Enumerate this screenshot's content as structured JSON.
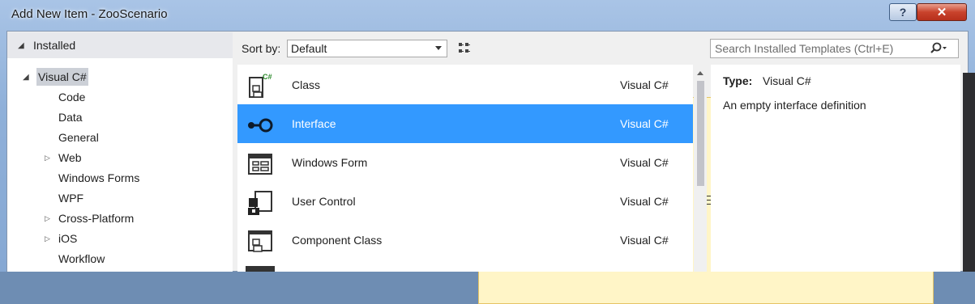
{
  "window": {
    "title": "Add New Item - ZooScenario",
    "help_label": "?",
    "close_label": "✕"
  },
  "sidebar": {
    "header": "Installed",
    "root": "Visual C#",
    "items": [
      {
        "label": "Code",
        "expandable": false
      },
      {
        "label": "Data",
        "expandable": false
      },
      {
        "label": "General",
        "expandable": false
      },
      {
        "label": "Web",
        "expandable": true
      },
      {
        "label": "Windows Forms",
        "expandable": false
      },
      {
        "label": "WPF",
        "expandable": false
      },
      {
        "label": "Cross-Platform",
        "expandable": true
      },
      {
        "label": "iOS",
        "expandable": true
      },
      {
        "label": "Workflow",
        "expandable": false
      }
    ]
  },
  "toolbar": {
    "sort_label": "Sort by:",
    "sort_value": "Default"
  },
  "search": {
    "placeholder": "Search Installed Templates (Ctrl+E)"
  },
  "templates": [
    {
      "name": "Class",
      "type": "Visual C#",
      "icon": "class-icon",
      "selected": false
    },
    {
      "name": "Interface",
      "type": "Visual C#",
      "icon": "interface-icon",
      "selected": true
    },
    {
      "name": "Windows Form",
      "type": "Visual C#",
      "icon": "windows-form-icon",
      "selected": false
    },
    {
      "name": "User Control",
      "type": "Visual C#",
      "icon": "user-control-icon",
      "selected": false
    },
    {
      "name": "Component Class",
      "type": "Visual C#",
      "icon": "component-class-icon",
      "selected": false
    }
  ],
  "details": {
    "type_label": "Type:",
    "type_value": "Visual C#",
    "description": "An empty interface definition"
  },
  "colors": {
    "selection": "#3399ff",
    "header_bg": "#e7e8ec",
    "title_gradient": "#a9c4e6"
  }
}
